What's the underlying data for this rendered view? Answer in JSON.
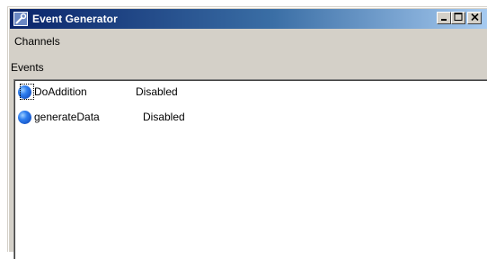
{
  "window": {
    "title": "Event Generator",
    "icon": "wrench-icon",
    "buttons": [
      "minimize-icon",
      "maximize-icon",
      "close-icon"
    ]
  },
  "menu": {
    "items": [
      {
        "label": "Channels"
      }
    ]
  },
  "events": {
    "label": "Events",
    "rows": [
      {
        "name": "DoAddition",
        "status": "Disabled",
        "focused": true
      },
      {
        "name": "generateData",
        "status": "Disabled",
        "focused": false
      }
    ]
  },
  "colors": {
    "title_start": "#0a246a",
    "title_end": "#a6caf0",
    "face": "#d4d0c8"
  }
}
